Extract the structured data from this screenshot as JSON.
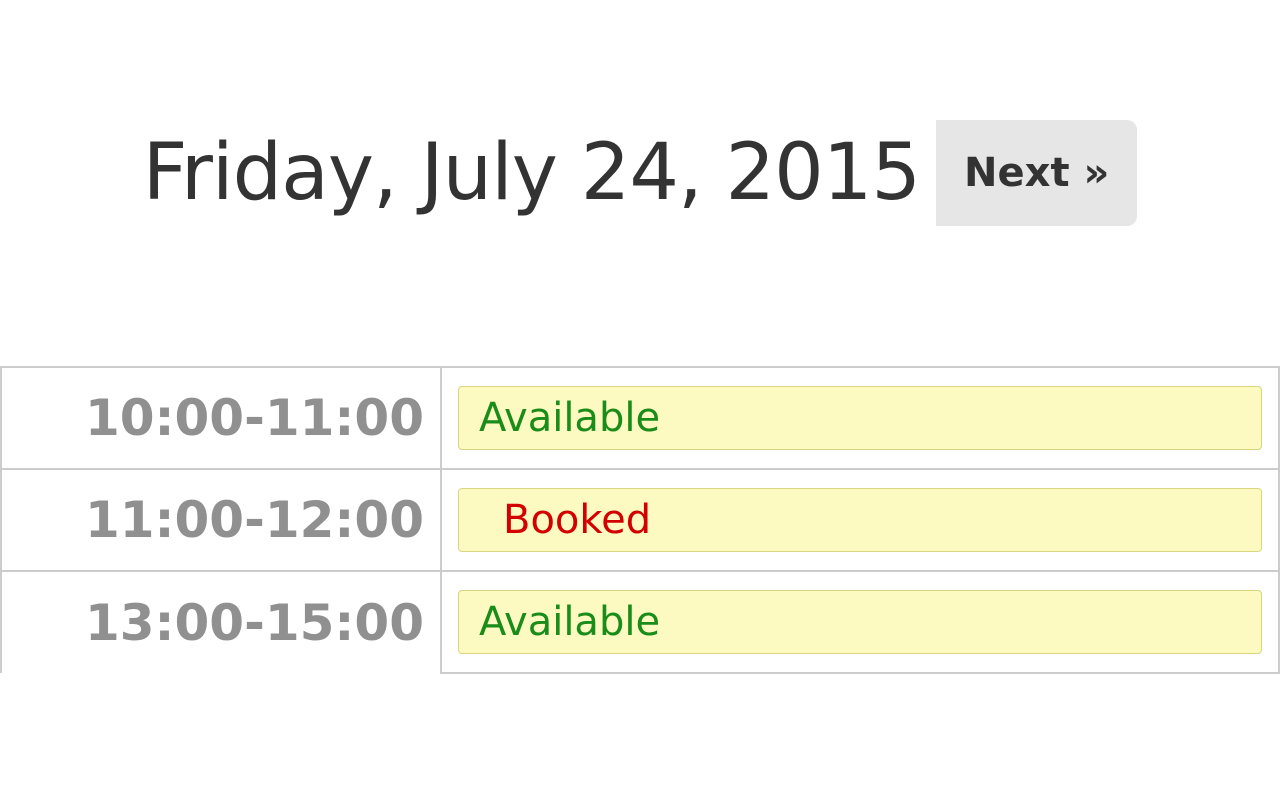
{
  "header": {
    "date_title": "Friday, July 24, 2015",
    "next_label": "Next »"
  },
  "schedule": {
    "rows": [
      {
        "time": "10:00-11:00",
        "status": "Available",
        "kind": "available"
      },
      {
        "time": "11:00-12:00",
        "status": "Booked",
        "kind": "booked"
      },
      {
        "time": "13:00-15:00",
        "status": "Available",
        "kind": "available"
      }
    ]
  }
}
